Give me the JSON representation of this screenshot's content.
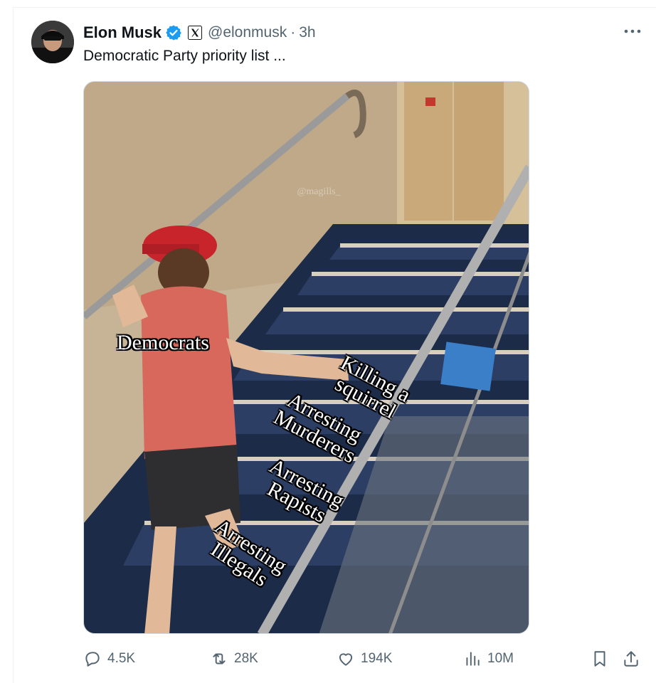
{
  "author": {
    "name": "Elon Musk",
    "handle": "@elonmusk",
    "separator": "·",
    "time": "3h"
  },
  "icons": {
    "verified": "verified-badge-icon",
    "affiliation": "x-logo-icon",
    "more": "more-options-icon"
  },
  "tweet": {
    "text": "Democratic Party priority list ..."
  },
  "media": {
    "watermark": "@magills_",
    "labels": {
      "democrats": "Democrats",
      "squirrel_1": "Killing a",
      "squirrel_2": "squirrel",
      "murderers_1": "Arresting",
      "murderers_2": "Murderers",
      "rapists_1": "Arresting",
      "rapists_2": "Rapists",
      "illegals_1": "Arresting",
      "illegals_2": "Illegals"
    }
  },
  "stats": {
    "replies": "4.5K",
    "reposts": "28K",
    "likes": "194K",
    "views": "10M"
  },
  "colors": {
    "text": "#0f1419",
    "secondary": "#536471",
    "verified": "#1d9bf0"
  }
}
